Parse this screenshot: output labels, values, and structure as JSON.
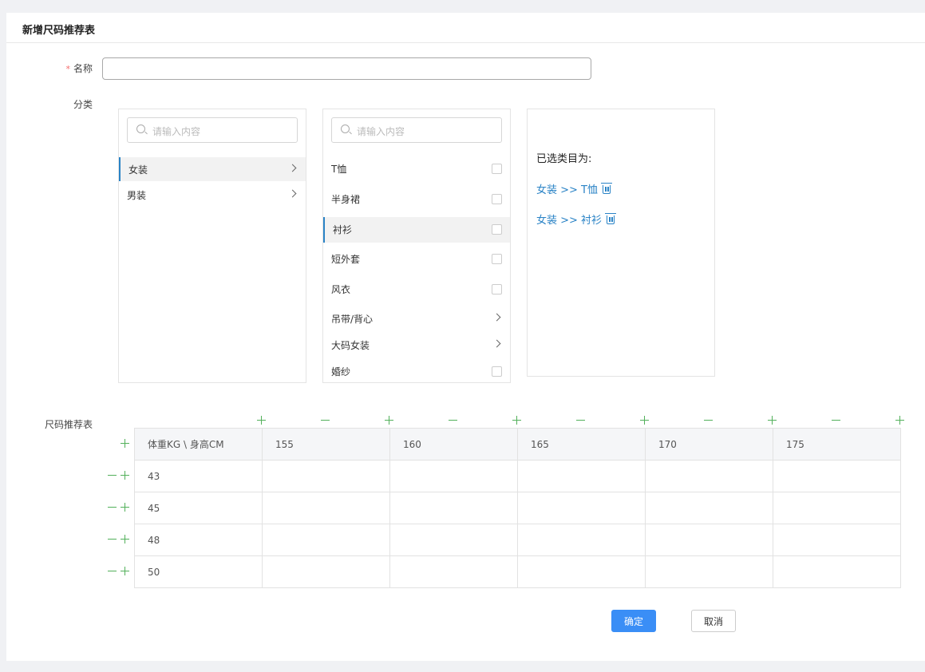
{
  "page": {
    "title": "新增尺码推荐表"
  },
  "form": {
    "name_label": "名称",
    "required_mark": "*",
    "name_value": "",
    "category_label": "分类",
    "size_table_label": "尺码推荐表"
  },
  "colors": {
    "accent": "#2a83c6",
    "primary_button": "#3a8ef6",
    "plus_minus": "#52b05a",
    "required": "#f56c6c"
  },
  "category_panel_1": {
    "search_placeholder": "请输入内容",
    "items": [
      {
        "label": "女装",
        "active": true,
        "has_children": true
      },
      {
        "label": "男装",
        "active": false,
        "has_children": true
      }
    ]
  },
  "category_panel_2": {
    "search_placeholder": "请输入内容",
    "items": [
      {
        "label": "T恤",
        "active": false,
        "type": "checkbox"
      },
      {
        "label": "半身裙",
        "active": false,
        "type": "checkbox"
      },
      {
        "label": "衬衫",
        "active": true,
        "type": "checkbox"
      },
      {
        "label": "短外套",
        "active": false,
        "type": "checkbox"
      },
      {
        "label": "风衣",
        "active": false,
        "type": "checkbox"
      },
      {
        "label": "吊带/背心",
        "active": false,
        "type": "chevron"
      },
      {
        "label": "大码女装",
        "active": false,
        "type": "chevron"
      },
      {
        "label": "婚纱",
        "active": false,
        "type": "checkbox"
      }
    ]
  },
  "selected_panel": {
    "title": "已选类目为:",
    "items": [
      "女装 >> T恤",
      "女装 >> 衬衫"
    ]
  },
  "size_table": {
    "corner": "体重KG \\ 身高CM",
    "heights": [
      "155",
      "160",
      "165",
      "170",
      "175"
    ],
    "weights": [
      "43",
      "45",
      "48",
      "50"
    ]
  },
  "buttons": {
    "confirm": "确定",
    "cancel": "取消"
  }
}
